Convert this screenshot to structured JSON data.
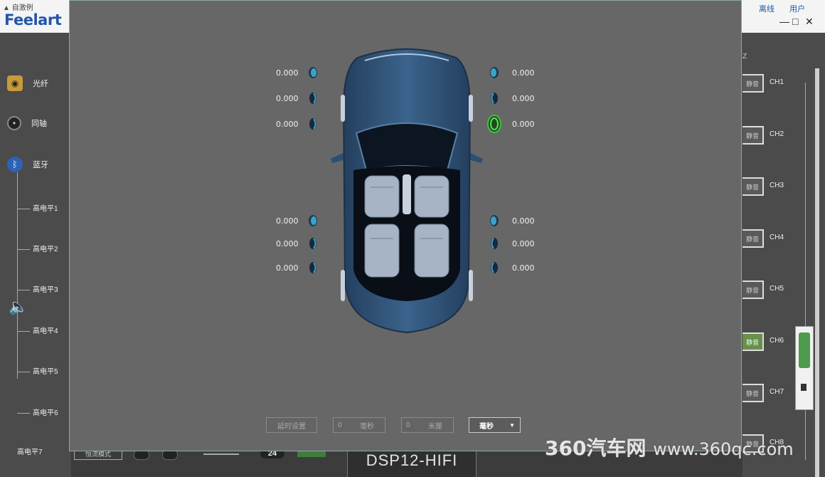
{
  "app": {
    "logo": "Feelart",
    "mini_tab": "自激例",
    "top_links": [
      "离线",
      "用户"
    ],
    "window_controls": [
      "—",
      "□",
      "✕"
    ],
    "bottom_title": "DSP12-HIFI",
    "watermark_brand": "360汽车网",
    "watermark_url": "www.360qc.com"
  },
  "sidebar": {
    "items": [
      {
        "label": "光纤",
        "icon": "fiber-icon"
      },
      {
        "label": "同轴",
        "icon": "coax-icon"
      },
      {
        "label": "蓝牙",
        "icon": "bluetooth-icon"
      }
    ],
    "tree": [
      "高电平1",
      "高电平2",
      "高电平3",
      "高电平4",
      "高电平5",
      "高电平6",
      "高电平7"
    ]
  },
  "right_panel": {
    "header": "Z",
    "channels": [
      {
        "button": "静音",
        "label": "CH1",
        "active": false
      },
      {
        "button": "静音",
        "label": "CH2",
        "active": false
      },
      {
        "button": "静音",
        "label": "CH3",
        "active": false
      },
      {
        "button": "静音",
        "label": "CH4",
        "active": false
      },
      {
        "button": "静音",
        "label": "CH5",
        "active": false
      },
      {
        "button": "静音",
        "label": "CH6",
        "active": true
      },
      {
        "button": "静音",
        "label": "CH7",
        "active": false
      },
      {
        "button": "静音",
        "label": "CH8",
        "active": false
      }
    ]
  },
  "bottom": {
    "box_label": "恒流模式",
    "value_24": "24"
  },
  "speakers": {
    "left_front": [
      {
        "value": "0.000",
        "type": "tweeter"
      },
      {
        "value": "0.000",
        "type": "mid"
      },
      {
        "value": "0.000",
        "type": "woofer"
      }
    ],
    "right_front": [
      {
        "value": "0.000",
        "type": "tweeter"
      },
      {
        "value": "0.000",
        "type": "mid"
      },
      {
        "value": "0.000",
        "type": "woofer",
        "selected": true
      }
    ],
    "left_rear": [
      {
        "value": "0.000",
        "type": "tweeter"
      },
      {
        "value": "0.000",
        "type": "mid"
      },
      {
        "value": "0.000",
        "type": "woofer"
      }
    ],
    "right_rear": [
      {
        "value": "0.000",
        "type": "tweeter"
      },
      {
        "value": "0.000",
        "type": "mid"
      },
      {
        "value": "0.000",
        "type": "woofer"
      }
    ]
  },
  "dialog_controls": {
    "auto_button": "延时设置",
    "field1_value": "0",
    "field1_unit": "毫秒",
    "field2_value": "0",
    "field2_unit": "米厘",
    "select_value": "毫秒"
  },
  "colors": {
    "dialog_bg": "#676767",
    "car_body": "#2d4f73",
    "speaker_blue": "#3aa3c8",
    "speaker_selected": "#39c53a"
  }
}
